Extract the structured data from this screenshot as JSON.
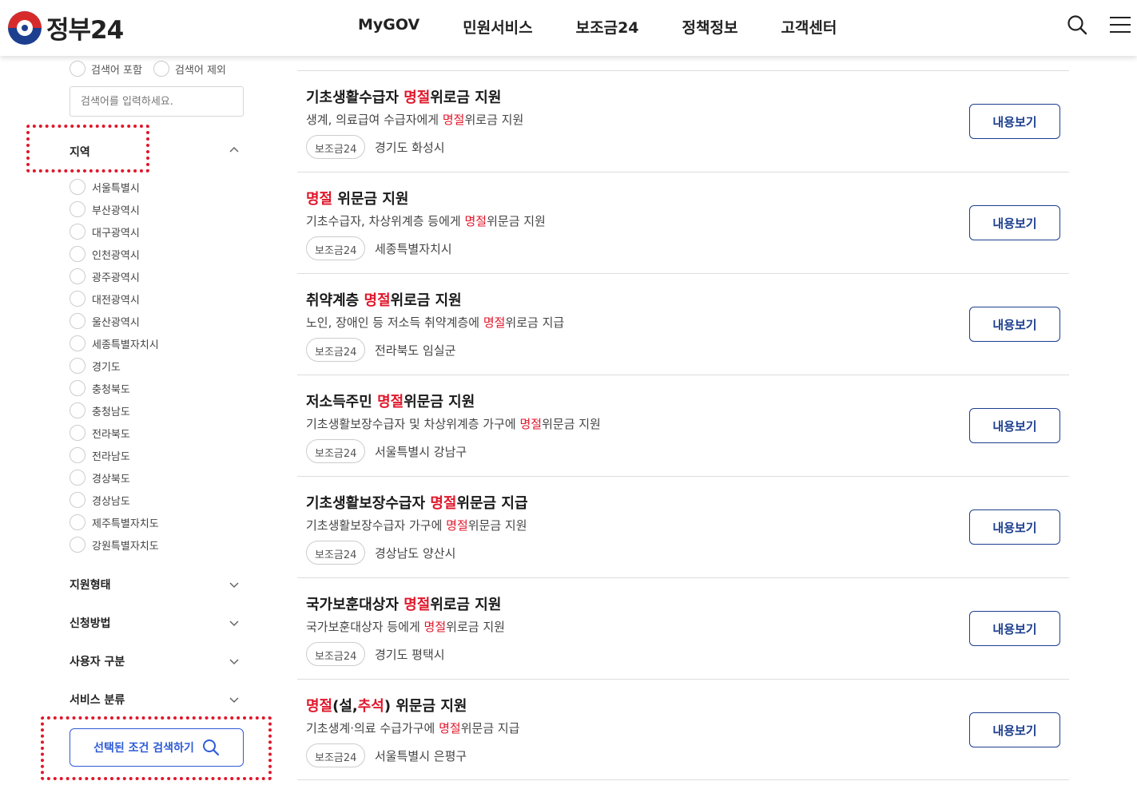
{
  "header": {
    "logo_text": "정부24",
    "nav": [
      "MyGOV",
      "민원서비스",
      "보조금24",
      "정책정보",
      "고객센터"
    ],
    "search_icon": "search-icon",
    "menu_icon": "hamburger-menu-icon"
  },
  "sidebar": {
    "include_label": "검색어 포함",
    "exclude_label": "검색어 제외",
    "keyword_placeholder": "검색어를 입력하세요.",
    "region_title": "지역",
    "regions": [
      "서울특별시",
      "부산광역시",
      "대구광역시",
      "인천광역시",
      "광주광역시",
      "대전광역시",
      "울산광역시",
      "세종특별자치시",
      "경기도",
      "충청북도",
      "충청남도",
      "전라북도",
      "전라남도",
      "경상북도",
      "경상남도",
      "제주특별자치도",
      "강원특별자치도"
    ],
    "support_type": "지원형태",
    "apply_method": "신청방법",
    "user_type": "사용자 구분",
    "service_category": "서비스 분류",
    "search_button": "선택된 조건 검색하기"
  },
  "results": [
    {
      "title_pre": "기초생활수급자 ",
      "title_hl": "명절",
      "title_post": "위로금 지원",
      "desc_pre": "생계, 의료급여 수급자에게 ",
      "desc_hl": "명절",
      "desc_post": "위로금 지원",
      "tag": "보조금24",
      "region": "경기도 화성시",
      "button": "내용보기"
    },
    {
      "title_pre": "",
      "title_hl": "명절",
      "title_post": " 위문금 지원",
      "desc_pre": "기초수급자, 차상위계층 등에게 ",
      "desc_hl": "명절",
      "desc_post": "위문금 지원",
      "tag": "보조금24",
      "region": "세종특별자치시",
      "button": "내용보기"
    },
    {
      "title_pre": "취약계층 ",
      "title_hl": "명절",
      "title_post": "위로금 지원",
      "desc_pre": "노인, 장애인 등 저소득 취약계층에 ",
      "desc_hl": "명절",
      "desc_post": "위로금 지급",
      "tag": "보조금24",
      "region": "전라북도 임실군",
      "button": "내용보기"
    },
    {
      "title_pre": "저소득주민 ",
      "title_hl": "명절",
      "title_post": "위문금 지원",
      "desc_pre": "기초생활보장수급자 및 차상위계층 가구에 ",
      "desc_hl": "명절",
      "desc_post": "위문금 지원",
      "tag": "보조금24",
      "region": "서울특별시 강남구",
      "button": "내용보기"
    },
    {
      "title_pre": "기초생활보장수급자 ",
      "title_hl": "명절",
      "title_post": "위문금 지급",
      "desc_pre": "기초생활보장수급자 가구에 ",
      "desc_hl": "명절",
      "desc_post": "위문금 지원",
      "tag": "보조금24",
      "region": "경상남도 양산시",
      "button": "내용보기"
    },
    {
      "title_pre": "국가보훈대상자 ",
      "title_hl": "명절",
      "title_post": "위로금 지원",
      "desc_pre": "국가보훈대상자 등에게 ",
      "desc_hl": "명절",
      "desc_post": "위로금 지원",
      "tag": "보조금24",
      "region": "경기도 평택시",
      "button": "내용보기"
    },
    {
      "title_pre": "",
      "title_hl": "명절",
      "title_post": "(설,추석) 위문금 지원",
      "desc_pre": "기초생계·의료 수급가구에 ",
      "desc_hl": "명절",
      "desc_post": "위문금 지급",
      "tag": "보조금24",
      "region": "서울특별시 은평구",
      "button": "내용보기"
    }
  ],
  "colors": {
    "highlight": "#e0172b",
    "primary": "#1d3f8f",
    "link": "#2e5bd7"
  }
}
